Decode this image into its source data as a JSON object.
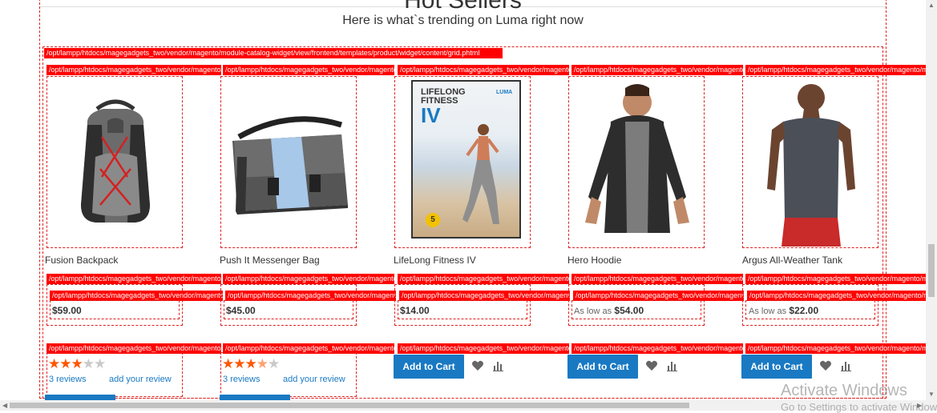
{
  "section": {
    "title": "Hot Sellers",
    "subtitle": "Here is what`s trending on Luma right now"
  },
  "debug": {
    "grid_path": "/opt/lampp/htdocs/magegadgets_two/vendor/magento/module-catalog-widget/view/frontend/templates/product/widget/content/grid.phtml",
    "item_path": "/opt/lampp/htdocs/magegadgets_two/vendor/magento/module-catalog/view/frontend/templates/product/",
    "item_path_long": "/opt/lampp/htdocs/magegadgets_two/vendor/magento/module-catalog/view/frontend/templates/product/price/amount/default.phtml"
  },
  "products": [
    {
      "name": "Fusion Backpack",
      "price_label": "",
      "price": "$59.00",
      "rating": 3,
      "reviews": "3  reviews",
      "add_review": "add your review"
    },
    {
      "name": "Push It Messenger Bag",
      "price_label": "",
      "price": "$45.00",
      "rating": 3.5,
      "reviews": "3  reviews",
      "add_review": "add your review"
    },
    {
      "name": "LifeLong Fitness IV",
      "price_label": "",
      "price": "$14.00",
      "cart": "Add to Cart"
    },
    {
      "name": "Hero Hoodie",
      "price_label": "As low as",
      "price": "$54.00",
      "cart": "Add to Cart"
    },
    {
      "name": "Argus All-Weather Tank",
      "price_label": "As low as",
      "price": "$22.00",
      "cart": "Add to Cart"
    }
  ],
  "dvd": {
    "title_line1": "LIFELONG",
    "title_line2": "FITNESS",
    "title_line3": "IV",
    "brand": "LUMA",
    "badge": "5"
  },
  "watermark": {
    "line1": "Activate Windows",
    "line2": "Go to Settings to activate Windows."
  },
  "colors": {
    "accent": "#1979c3",
    "star": "#ff5501",
    "debug": "#ff0000"
  }
}
